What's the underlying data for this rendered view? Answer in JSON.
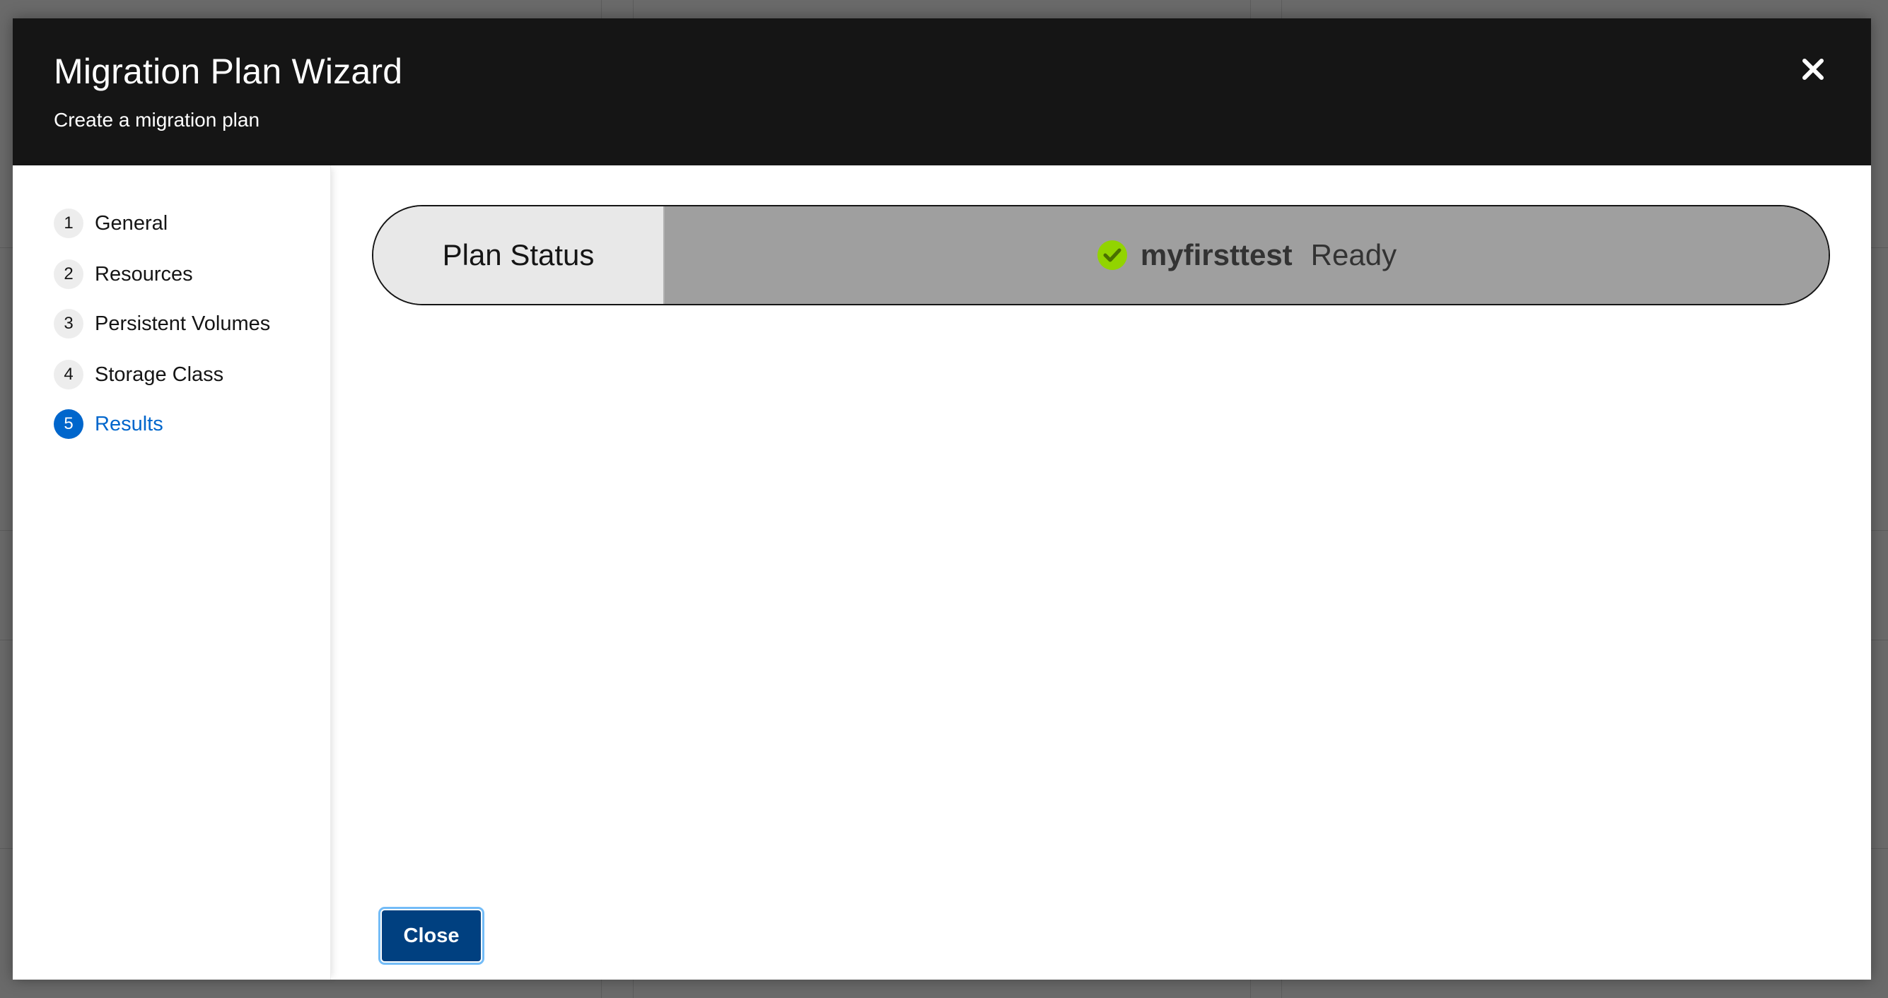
{
  "modal": {
    "title": "Migration Plan Wizard",
    "subtitle": "Create a migration plan",
    "close_icon": "close-icon"
  },
  "nav": {
    "items": [
      {
        "number": "1",
        "label": "General"
      },
      {
        "number": "2",
        "label": "Resources"
      },
      {
        "number": "3",
        "label": "Persistent Volumes"
      },
      {
        "number": "4",
        "label": "Storage Class"
      },
      {
        "number": "5",
        "label": "Results"
      }
    ],
    "active_index": 4
  },
  "status": {
    "label": "Plan Status",
    "plan_name": "myfirsttest",
    "state": "Ready",
    "icon": "check-circle-icon"
  },
  "footer": {
    "close_label": "Close"
  },
  "colors": {
    "header_bg": "#151515",
    "active": "#0066cc",
    "success": "#92d400",
    "primary_button": "#004080"
  }
}
